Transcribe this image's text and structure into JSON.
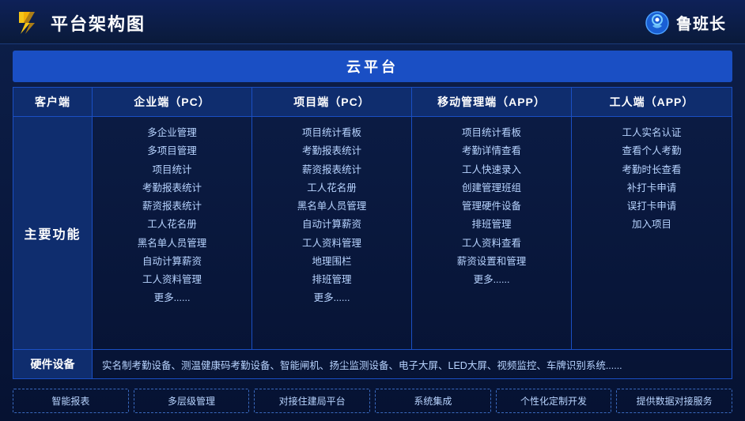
{
  "header": {
    "title": "平台架构图",
    "brand_name": "鲁班长"
  },
  "cloud_bar": "云平台",
  "columns": [
    {
      "id": "client",
      "label": "客户端"
    },
    {
      "id": "enterprise",
      "label": "企业端（PC）"
    },
    {
      "id": "project",
      "label": "项目端（PC）"
    },
    {
      "id": "mobile",
      "label": "移动管理端（APP）"
    },
    {
      "id": "worker",
      "label": "工人端（APP）"
    }
  ],
  "main_function_label": "主要功能",
  "column_items": {
    "enterprise": [
      "多企业管理",
      "多项目管理",
      "项目统计",
      "考勤报表统计",
      "薪资报表统计",
      "工人花名册",
      "黑名单人员管理",
      "自动计算薪资",
      "工人资料管理",
      "更多......"
    ],
    "project": [
      "项目统计看板",
      "考勤报表统计",
      "薪资报表统计",
      "工人花名册",
      "黑名单人员管理",
      "自动计算薪资",
      "工人资料管理",
      "地理围栏",
      "排班管理",
      "更多......"
    ],
    "mobile": [
      "项目统计看板",
      "考勤详情查看",
      "工人快速录入",
      "创建管理班组",
      "管理硬件设备",
      "排班管理",
      "工人资料查看",
      "薪资设置和管理",
      "更多......"
    ],
    "worker": [
      "工人实名认证",
      "查看个人考勤",
      "考勤时长查看",
      "补打卡申请",
      "误打卡申请",
      "加入项目"
    ]
  },
  "hardware": {
    "label": "硬件设备",
    "content": "实名制考勤设备、测温健康码考勤设备、智能闸机、扬尘监测设备、电子大屏、LED大屏、视频监控、车牌识别系统......"
  },
  "features": [
    "智能报表",
    "多层级管理",
    "对接住建局平台",
    "系统集成",
    "个性化定制开发",
    "提供数据对接服务"
  ]
}
